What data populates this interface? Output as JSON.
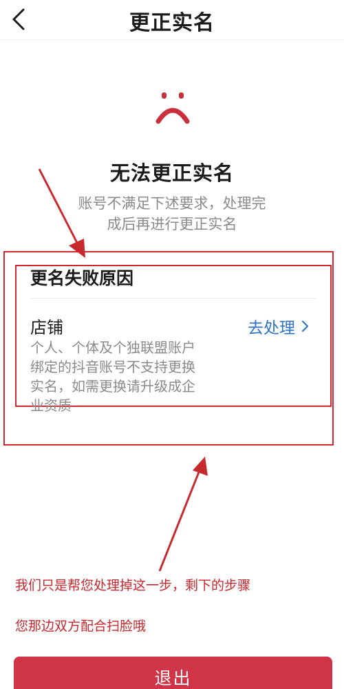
{
  "header": {
    "title": "更正实名"
  },
  "status": {
    "title": "无法更正实名",
    "description_line1": "账号不满足下述要求，处理完",
    "description_line2": "成后再进行更正实名"
  },
  "reason_card": {
    "title": "更名失败原因",
    "item": {
      "name": "店铺",
      "action_label": "去处理",
      "desc_line1": "个人、个体及个独联盟账户",
      "desc_line2": "绑定的抖音账号不支持更换",
      "desc_line3": "实名，如需更换请升级成企",
      "desc_line4": "业资质"
    }
  },
  "annotation": {
    "line1": "我们只是帮您处理掉这一步，剩下的步骤",
    "line2": "您那边双方配合扫脸哦",
    "color": "#d4262d"
  },
  "footer": {
    "exit_label": "退出"
  },
  "colors": {
    "accent_red": "#cf3546",
    "link_blue": "#2d73c4",
    "sad_icon": "#c9303c",
    "annotation_red": "#c8262c"
  },
  "icons": {
    "back": "chevron-left-icon",
    "status": "sad-face-icon",
    "action": "chevron-right-icon"
  }
}
